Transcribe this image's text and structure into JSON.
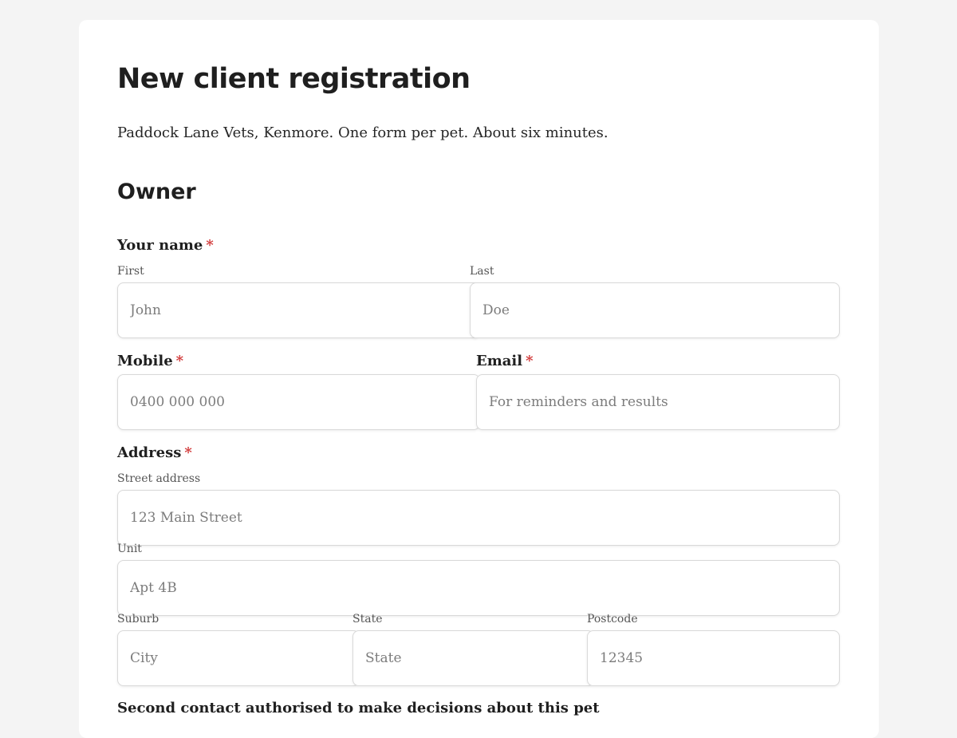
{
  "form": {
    "title": "New client registration",
    "subtitle": "Paddock Lane Vets, Kenmore. One form per pet. About six minutes.",
    "required_marker": "*",
    "owner_section": {
      "heading": "Owner",
      "name": {
        "label": "Your name",
        "first": {
          "sublabel": "First",
          "placeholder": "John"
        },
        "last": {
          "sublabel": "Last",
          "placeholder": "Doe"
        }
      },
      "mobile": {
        "label": "Mobile",
        "placeholder": "0400 000 000"
      },
      "email": {
        "label": "Email",
        "placeholder": "For reminders and results"
      },
      "address": {
        "label": "Address",
        "street": {
          "sublabel": "Street address",
          "placeholder": "123 Main Street"
        },
        "unit": {
          "sublabel": "Unit",
          "placeholder": "Apt 4B"
        },
        "suburb": {
          "sublabel": "Suburb",
          "placeholder": "City"
        },
        "state": {
          "sublabel": "State",
          "placeholder": "State"
        },
        "postcode": {
          "sublabel": "Postcode",
          "placeholder": "12345"
        }
      },
      "second_contact": {
        "label": "Second contact authorised to make decisions about this pet"
      }
    }
  },
  "colors": {
    "page_background": "#f4f4f4",
    "card_background": "#ffffff",
    "required_marker": "#d23c3c",
    "field_border": "#d9d9d9",
    "text": "#1f1f1f"
  }
}
